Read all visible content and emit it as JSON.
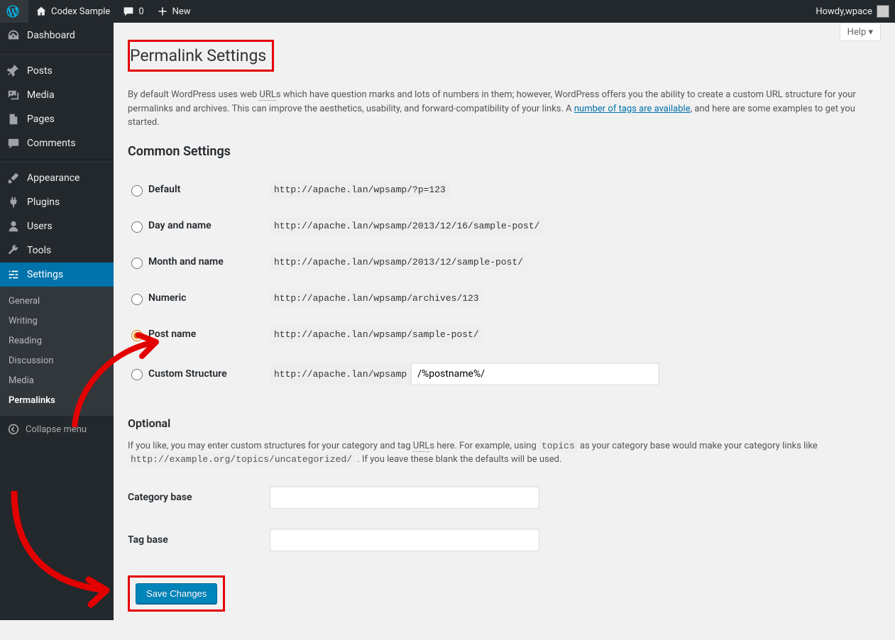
{
  "adminbar": {
    "site_name": "Codex Sample",
    "comments_count": "0",
    "new_label": "New",
    "howdy_prefix": "Howdy, ",
    "username": "wpace"
  },
  "sidebar": {
    "dashboard": "Dashboard",
    "posts": "Posts",
    "media": "Media",
    "pages": "Pages",
    "comments": "Comments",
    "appearance": "Appearance",
    "plugins": "Plugins",
    "users": "Users",
    "tools": "Tools",
    "settings": "Settings",
    "settings_sub": {
      "general": "General",
      "writing": "Writing",
      "reading": "Reading",
      "discussion": "Discussion",
      "media": "Media",
      "permalinks": "Permalinks"
    },
    "collapse": "Collapse menu"
  },
  "help_label": "Help ▾",
  "page_title": "Permalink Settings",
  "intro": {
    "before_urls": "By default WordPress uses web ",
    "urls_word": "URL",
    "after_urls": "s which have question marks and lots of numbers in them; however, WordPress offers you the ability to create a custom URL structure for your permalinks and archives. This can improve the aesthetics, usability, and forward-compatibility of your links. A ",
    "link_text": "number of tags are available",
    "after_link": ", and here are some examples to get you started."
  },
  "common_heading": "Common Settings",
  "options": {
    "default": {
      "label": "Default",
      "url": "http://apache.lan/wpsamp/?p=123"
    },
    "day_name": {
      "label": "Day and name",
      "url": "http://apache.lan/wpsamp/2013/12/16/sample-post/"
    },
    "month_name": {
      "label": "Month and name",
      "url": "http://apache.lan/wpsamp/2013/12/sample-post/"
    },
    "numeric": {
      "label": "Numeric",
      "url": "http://apache.lan/wpsamp/archives/123"
    },
    "post_name": {
      "label": "Post name",
      "url": "http://apache.lan/wpsamp/sample-post/"
    },
    "custom": {
      "label": "Custom Structure",
      "prefix": "http://apache.lan/wpsamp",
      "value": "/%postname%/"
    }
  },
  "optional_heading": "Optional",
  "optional_text": {
    "part1": "If you like, you may enter custom structures for your category and tag ",
    "urls_word": "URL",
    "part2": "s here. For example, using ",
    "topics_code": "topics",
    "part3": " as your category base would make your category links like ",
    "example_code": "http://example.org/topics/uncategorized/",
    "part4": " . If you leave these blank the defaults will be used."
  },
  "category_base_label": "Category base",
  "tag_base_label": "Tag base",
  "save_label": "Save Changes"
}
